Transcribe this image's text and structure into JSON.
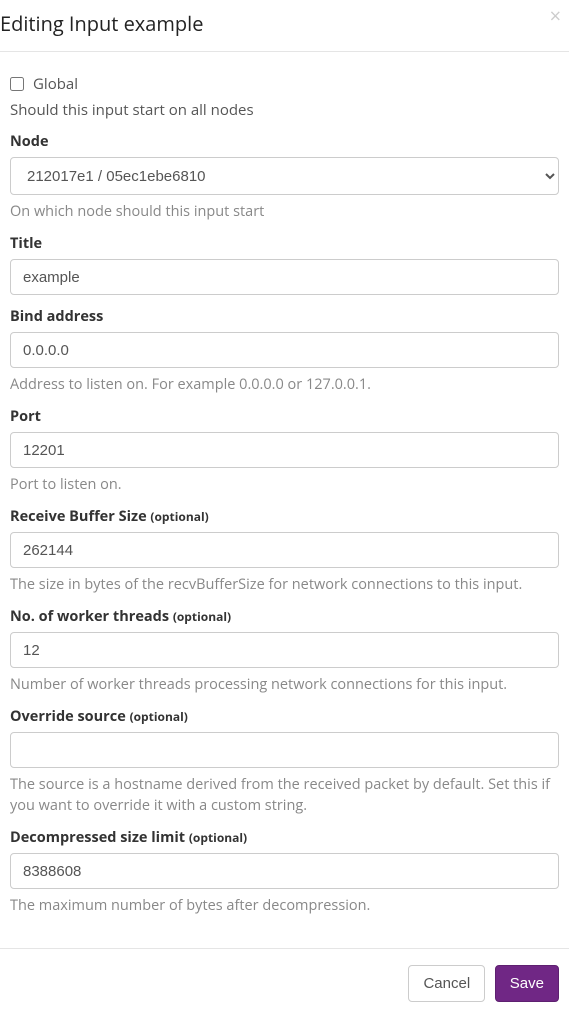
{
  "header": {
    "title": "Editing Input example"
  },
  "global": {
    "label": "Global",
    "help": "Should this input start on all nodes"
  },
  "node": {
    "label": "Node",
    "selected": "212017e1 / 05ec1ebe6810",
    "help": "On which node should this input start"
  },
  "titleField": {
    "label": "Title",
    "value": "example"
  },
  "bind": {
    "label": "Bind address",
    "value": "0.0.0.0",
    "help": "Address to listen on. For example 0.0.0.0 or 127.0.0.1."
  },
  "port": {
    "label": "Port",
    "value": "12201",
    "help": "Port to listen on."
  },
  "recvBuf": {
    "label": "Receive Buffer Size",
    "optional": "(optional)",
    "value": "262144",
    "help": "The size in bytes of the recvBufferSize for network connections to this input."
  },
  "workers": {
    "label": "No. of worker threads",
    "optional": "(optional)",
    "value": "12",
    "help": "Number of worker threads processing network connections for this input."
  },
  "overrideSource": {
    "label": "Override source",
    "optional": "(optional)",
    "value": "",
    "help": "The source is a hostname derived from the received packet by default. Set this if you want to override it with a custom string."
  },
  "decompressed": {
    "label": "Decompressed size limit",
    "optional": "(optional)",
    "value": "8388608",
    "help": "The maximum number of bytes after decompression."
  },
  "footer": {
    "cancel": "Cancel",
    "save": "Save"
  }
}
